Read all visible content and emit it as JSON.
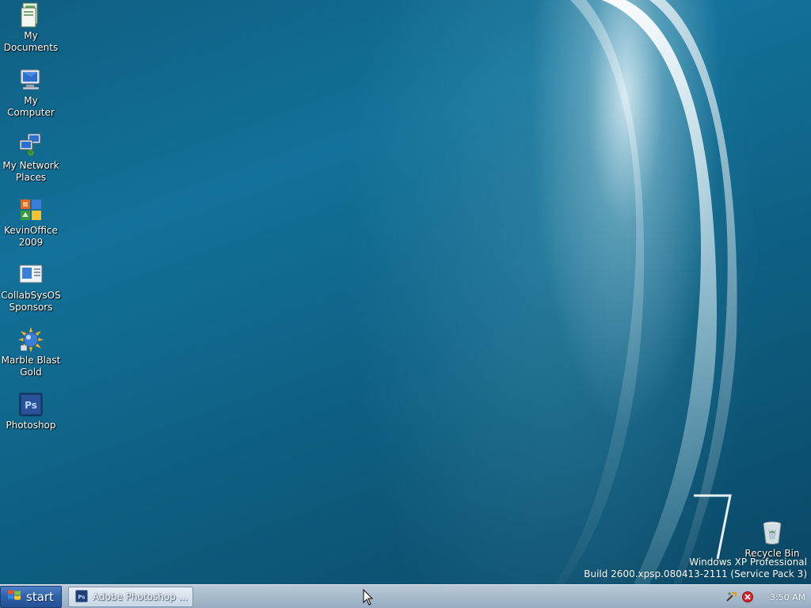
{
  "desktop": {
    "icons": [
      {
        "label": "My\nDocuments",
        "icon": "my-documents-icon"
      },
      {
        "label": "My Computer",
        "icon": "my-computer-icon"
      },
      {
        "label": "My Network\nPlaces",
        "icon": "my-network-places-icon"
      },
      {
        "label": "KevinOffice\n2009",
        "icon": "kevinoffice-icon"
      },
      {
        "label": "CollabSysOS\nSponsors",
        "icon": "collabsysos-sponsors-icon"
      },
      {
        "label": "Marble Blast\nGold",
        "icon": "marble-blast-icon"
      },
      {
        "label": "Photoshop",
        "icon": "photoshop-icon"
      }
    ],
    "recycle_bin": {
      "label": "Recycle Bin",
      "icon": "recycle-bin-icon"
    },
    "wallpaper_mark": "7",
    "watermark": {
      "line1": "Windows XP Professional",
      "line2": "Build 2600.xpsp.080413-2111 (Service Pack 3)"
    }
  },
  "taskbar": {
    "start_label": "start",
    "tasks": [
      {
        "label": "Adobe Photoshop ...",
        "icon": "photoshop-task-icon"
      }
    ],
    "tray": {
      "icons": [
        "network-tools-icon",
        "security-alert-icon"
      ],
      "clock": "3:50 AM"
    }
  },
  "colors": {
    "taskbar": "#a9bccd",
    "start_button": "#2f60a8",
    "desktop": "#12719a"
  }
}
